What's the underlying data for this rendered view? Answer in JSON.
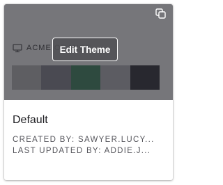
{
  "preview": {
    "name": "ACME ORANGE",
    "edit_label": "Edit Theme",
    "icons": {
      "copy": "copy-icon",
      "device": "monitor-icon"
    },
    "swatches": [
      "#5e5e62",
      "#4a4a52",
      "#2e4a3f",
      "#5c5c62",
      "#28282f"
    ],
    "overlay_color": "#76767a"
  },
  "theme": {
    "title": "Default",
    "created_by": "CREATED BY: SAWYER.LUCY...",
    "updated_by": "LAST UPDATED BY: ADDIE.J..."
  }
}
